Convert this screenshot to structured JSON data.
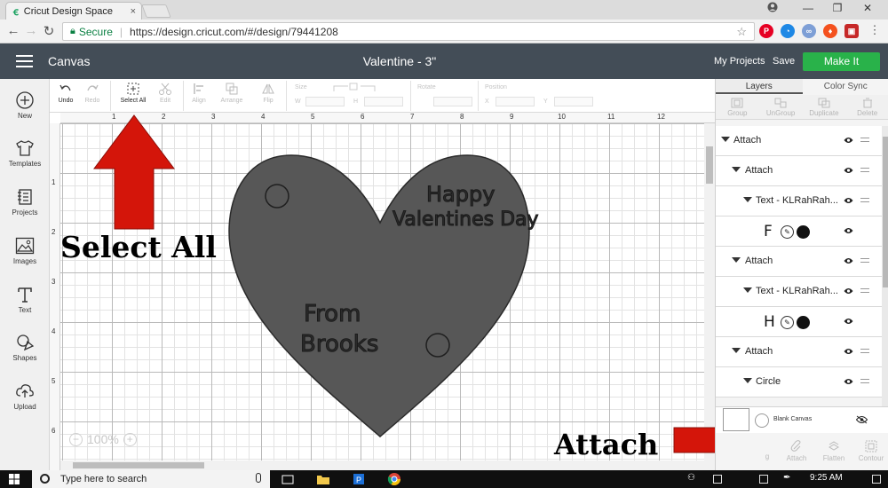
{
  "browser": {
    "tab_title": "Cricut Design Space",
    "tab_close": "×",
    "win_minimize": "—",
    "win_restore": "❐",
    "win_close": "✕",
    "secure_label": "Secure",
    "url": "https://design.cricut.com/#/design/79441208"
  },
  "header": {
    "section": "Canvas",
    "project_title": "Valentine - 3\"",
    "my_projects": "My Projects",
    "save": "Save",
    "make_it": "Make It",
    "accent": "#29b24a"
  },
  "sidebar": {
    "items": [
      {
        "label": "New",
        "icon": "plus-circle-icon"
      },
      {
        "label": "Templates",
        "icon": "shirt-icon"
      },
      {
        "label": "Projects",
        "icon": "projects-icon"
      },
      {
        "label": "Images",
        "icon": "image-icon"
      },
      {
        "label": "Text",
        "icon": "text-icon"
      },
      {
        "label": "Shapes",
        "icon": "shapes-icon"
      },
      {
        "label": "Upload",
        "icon": "upload-cloud-icon"
      }
    ]
  },
  "toolbar": {
    "undo": "Undo",
    "redo": "Redo",
    "select_all": "Select All",
    "edit": "Edit",
    "align": "Align",
    "arrange": "Arrange",
    "flip": "Flip",
    "size": "Size",
    "w": "W",
    "h": "H",
    "rotate": "Rotate",
    "position": "Position",
    "x": "X",
    "y": "Y"
  },
  "canvas": {
    "h_ruler": [
      "1",
      "2",
      "3",
      "4",
      "5",
      "6",
      "7",
      "8",
      "9",
      "10",
      "11",
      "12"
    ],
    "v_ruler": [
      "1",
      "2",
      "3",
      "4",
      "5",
      "6"
    ],
    "zoom": "100%",
    "zoom_minus": "−",
    "zoom_plus": "+",
    "heart_text_1_line_1": "Happy",
    "heart_text_1_line_2": "Valentines Day",
    "heart_text_2_line_1": "From",
    "heart_text_2_line_2": "Brooks",
    "heart_color": "#575757"
  },
  "annotations": {
    "select_all": "Select All",
    "attach": "Attach",
    "arrow_color": "#d4150a"
  },
  "layers_panel": {
    "tabs": [
      "Layers",
      "Color Sync"
    ],
    "ops": [
      "Group",
      "UnGroup",
      "Duplicate",
      "Delete"
    ],
    "rows": [
      {
        "label": "Attach"
      },
      {
        "label": "Attach"
      },
      {
        "label": "Text - KLRahRah..."
      },
      {
        "glyph": "F"
      },
      {
        "label": "Attach"
      },
      {
        "label": "Text - KLRahRah..."
      },
      {
        "glyph": "H"
      },
      {
        "label": "Attach"
      },
      {
        "label": "Circle"
      }
    ],
    "blank_canvas": "Blank Canvas",
    "bottom_ops": [
      "Attach",
      "Flatten",
      "Contour"
    ],
    "bottom_partial": "g"
  },
  "taskbar": {
    "search_placeholder": "Type here to search",
    "time": "9:25 AM"
  }
}
